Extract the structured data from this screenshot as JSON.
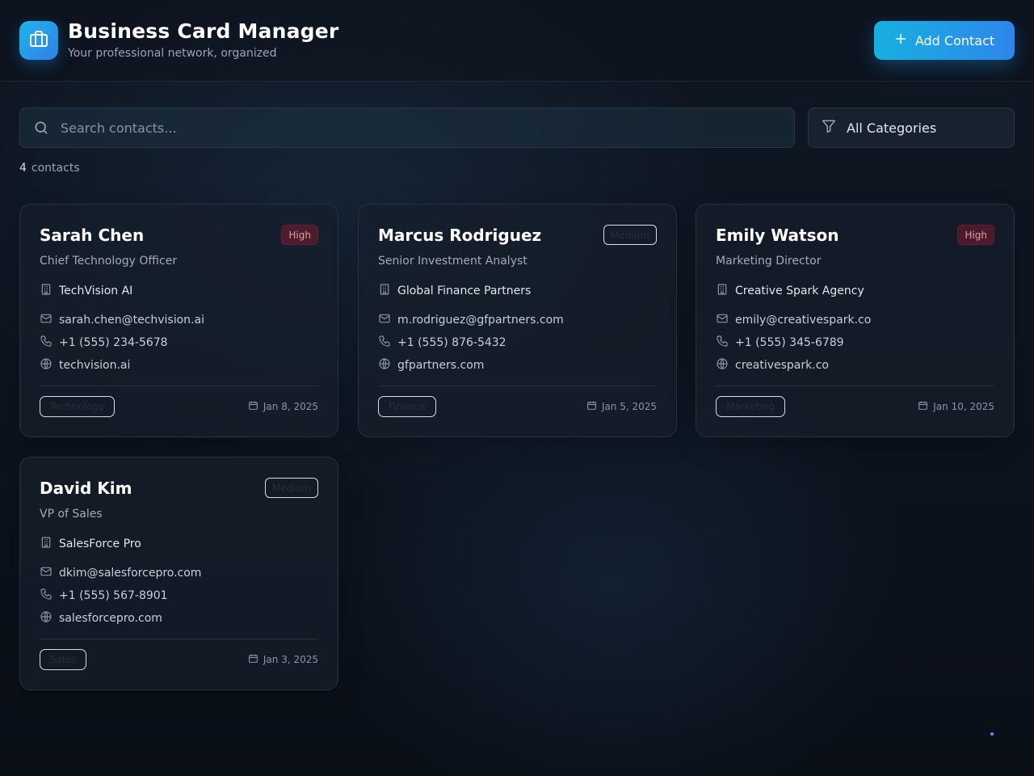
{
  "app": {
    "title": "Business Card Manager",
    "subtitle": "Your professional network, organized",
    "logo_icon": "briefcase-icon",
    "accent_gradient": [
      "#17b0e0",
      "#2f86ea"
    ]
  },
  "toolbar": {
    "add_label": "Add Contact",
    "add_icon": "plus-icon"
  },
  "search": {
    "placeholder": "Search contacts...",
    "value": "",
    "icon": "search-icon"
  },
  "filter": {
    "selected": "All Categories",
    "icon": "filter-icon"
  },
  "summary": {
    "count": "4",
    "count_label": "contacts"
  },
  "contacts": [
    {
      "name": "Sarah Chen",
      "role": "Chief Technology Officer",
      "company": "TechVision AI",
      "email": "sarah.chen@techvision.ai",
      "phone": "+1 (555) 234-5678",
      "website": "techvision.ai",
      "priority": "High",
      "tag": "Technology",
      "date": "Jan 8, 2025"
    },
    {
      "name": "Marcus Rodriguez",
      "role": "Senior Investment Analyst",
      "company": "Global Finance Partners",
      "email": "m.rodriguez@gfpartners.com",
      "phone": "+1 (555) 876-5432",
      "website": "gfpartners.com",
      "priority": "Medium",
      "tag": "Finance",
      "date": "Jan 5, 2025"
    },
    {
      "name": "Emily Watson",
      "role": "Marketing Director",
      "company": "Creative Spark Agency",
      "email": "emily@creativespark.co",
      "phone": "+1 (555) 345-6789",
      "website": "creativespark.co",
      "priority": "High",
      "tag": "Marketing",
      "date": "Jan 10, 2025"
    },
    {
      "name": "David Kim",
      "role": "VP of Sales",
      "company": "SalesForce Pro",
      "email": "dkim@salesforcepro.com",
      "phone": "+1 (555) 567-8901",
      "website": "salesforcepro.com",
      "priority": "Medium",
      "tag": "Sales",
      "date": "Jan 3, 2025"
    }
  ],
  "colors": {
    "background": "#0d1520",
    "card": "#161e2a",
    "high_badge": "#781e2d",
    "muted_text": "#8a94a3"
  }
}
